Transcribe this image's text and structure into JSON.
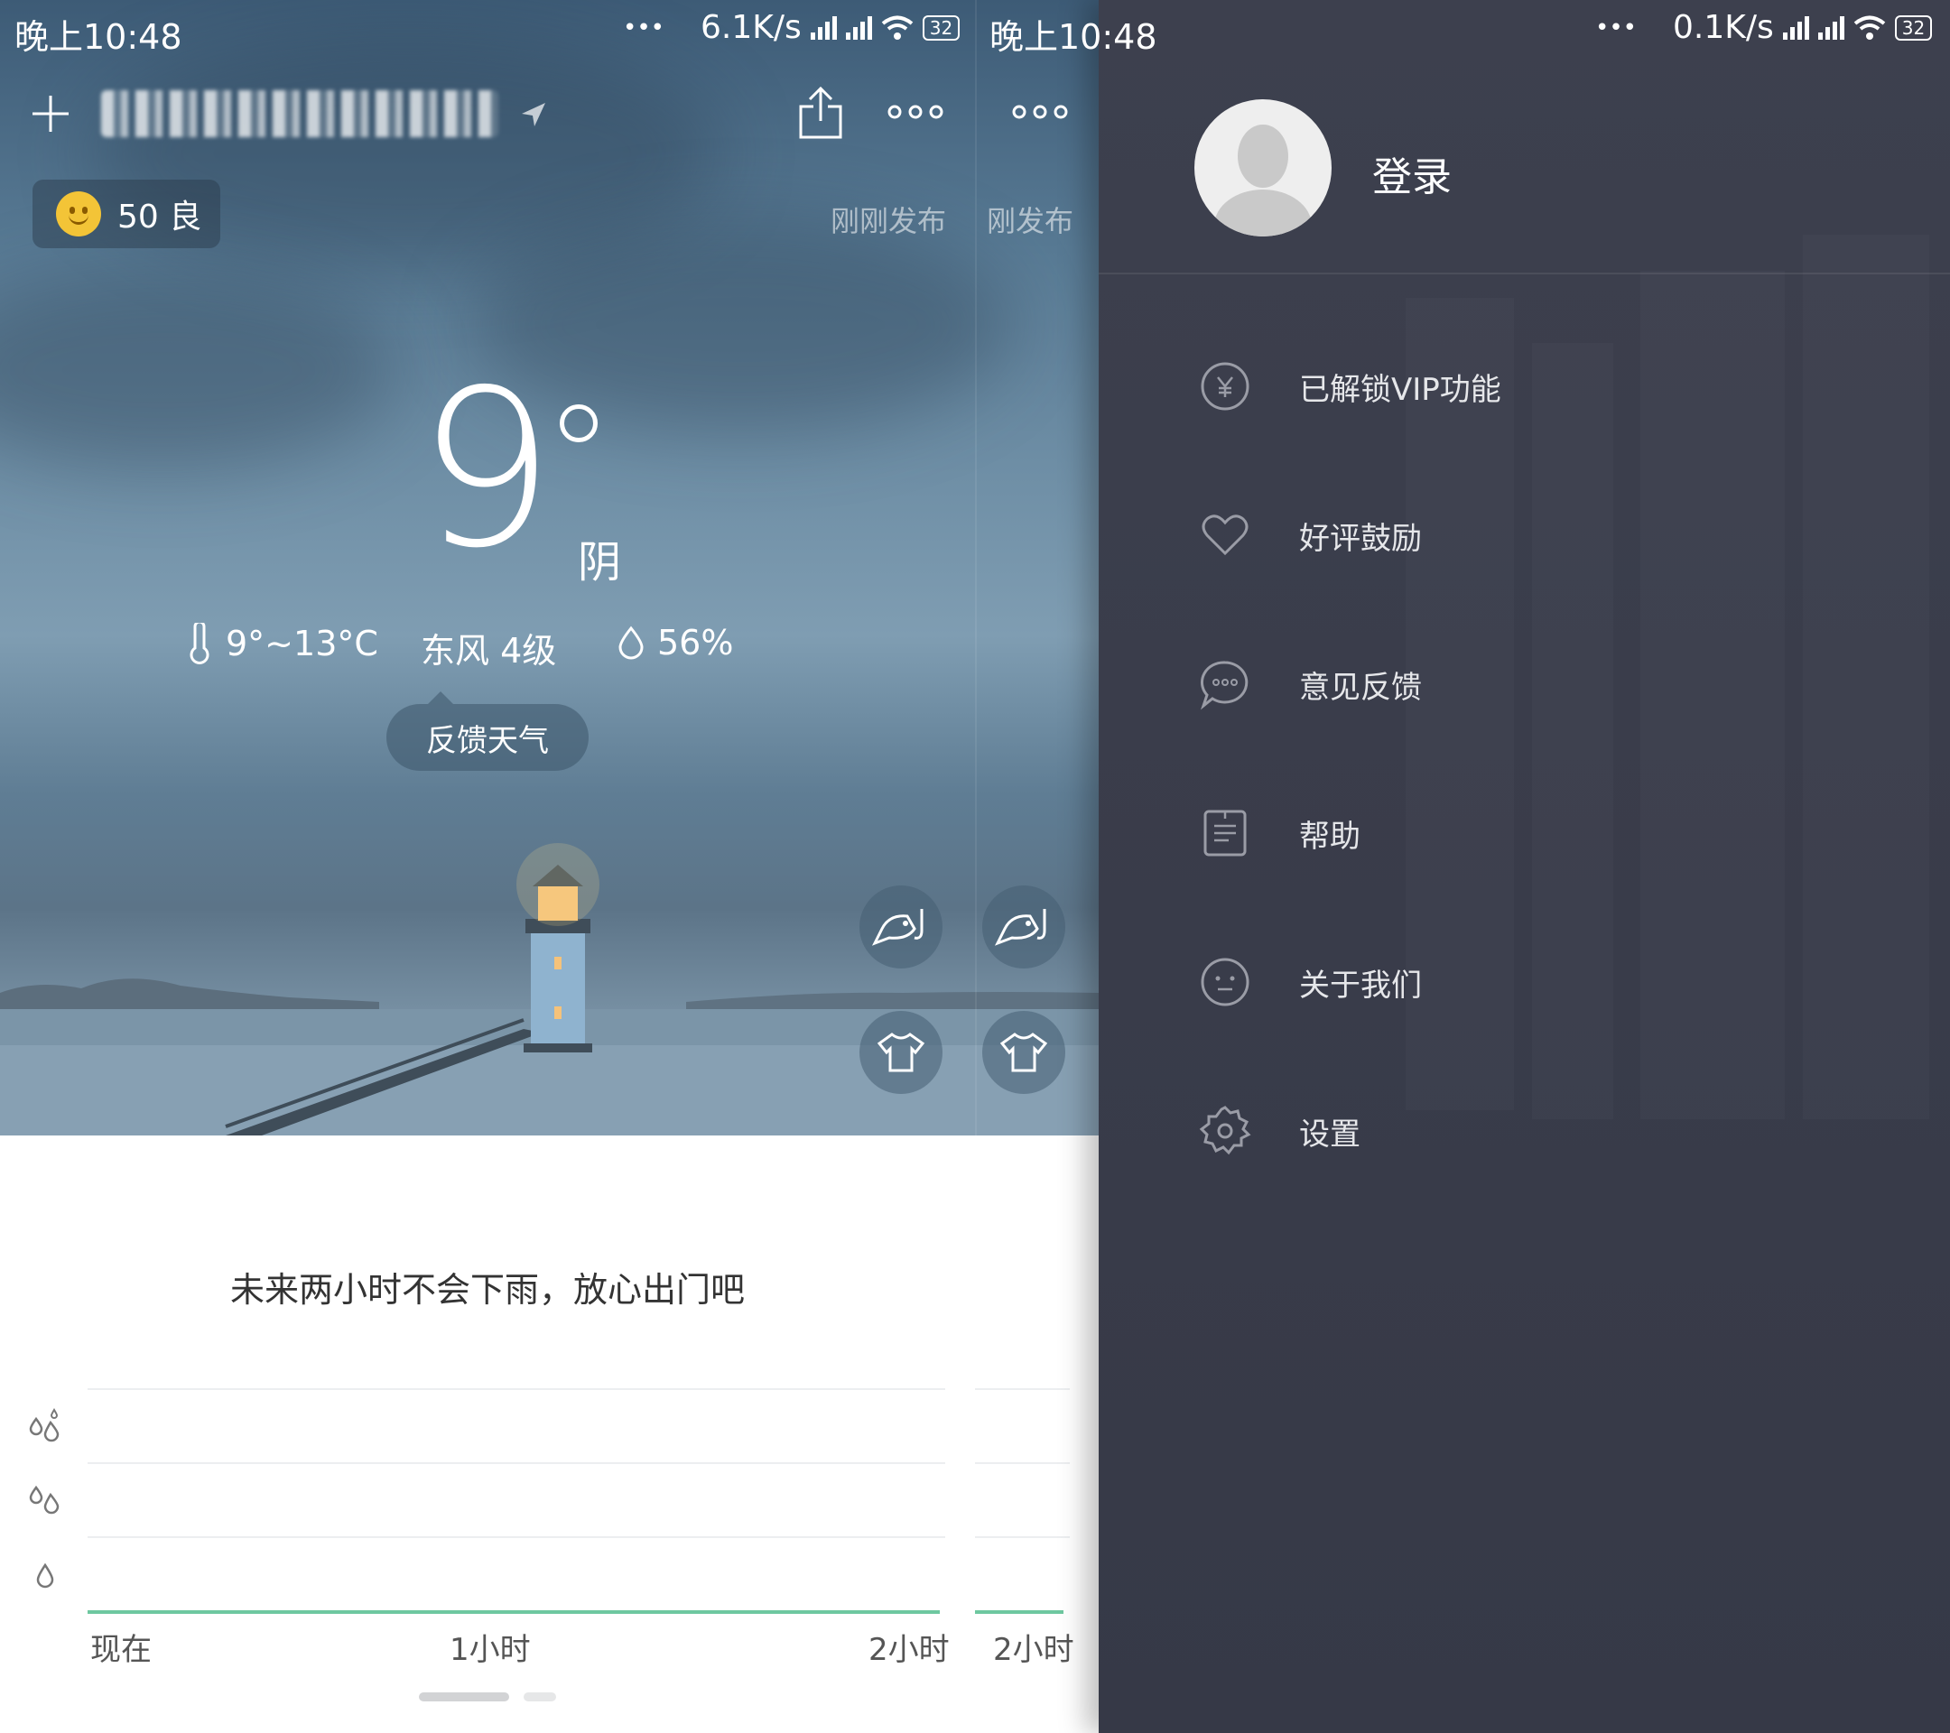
{
  "weather": {
    "status_bar": {
      "time": "晚上10:48",
      "dots": "•••",
      "speed": "6.1K/s",
      "battery": "32"
    },
    "header": {
      "add_icon": "plus-icon",
      "share_icon": "share-icon",
      "more_icon": "more-icon",
      "more_label": "ooo"
    },
    "aqi": {
      "value": "50",
      "level": "良",
      "text": "50 良"
    },
    "published": "刚刚发布",
    "published_partial": "刚发布",
    "current": {
      "temp": "9",
      "condition": "阴",
      "range": "9°~13°C",
      "wind": "东风 4级",
      "humidity": "56%"
    },
    "feedback_label": "反馈天气",
    "rain_message": "未来两小时不会下雨，放心出门吧",
    "rain_axis": {
      "labels": [
        "现在",
        "1小时",
        "2小时"
      ],
      "partial_label": "2小时"
    }
  },
  "status_bar2": {
    "time": "晚上10:48",
    "dots": "•••",
    "speed": "0.1K/s",
    "battery": "32"
  },
  "drawer": {
    "login_label": "登录",
    "menu": [
      {
        "label": "已解锁VIP功能",
        "icon": "yen-icon"
      },
      {
        "label": "好评鼓励",
        "icon": "heart-icon"
      },
      {
        "label": "意见反馈",
        "icon": "chat-icon"
      },
      {
        "label": "帮助",
        "icon": "document-icon"
      },
      {
        "label": "关于我们",
        "icon": "face-icon"
      },
      {
        "label": "设置",
        "icon": "gear-icon"
      }
    ]
  }
}
